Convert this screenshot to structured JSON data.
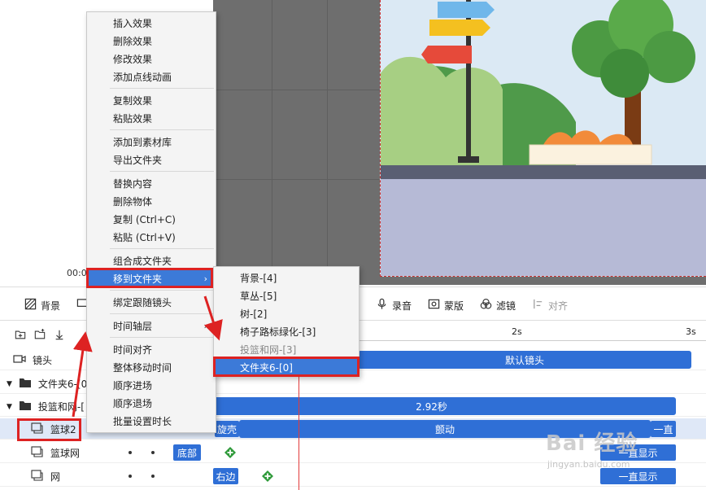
{
  "canvas": {
    "timecode": "00:0"
  },
  "toolbar": {
    "items": [
      {
        "label": "背景",
        "icon": "background-icon"
      },
      {
        "label": "录音",
        "icon": "microphone-icon"
      },
      {
        "label": "蒙版",
        "icon": "mask-icon"
      },
      {
        "label": "滤镜",
        "icon": "filter-icon"
      },
      {
        "label": "对齐",
        "icon": "align-icon"
      }
    ]
  },
  "timeline": {
    "ruler": [
      "2s",
      "3s"
    ],
    "rows": [
      {
        "label": "镜头",
        "icon": "camera-icon",
        "clip": "默认镜头"
      },
      {
        "label": "文件夹6-[0",
        "icon": "folder-icon"
      },
      {
        "label": "投篮和网-[",
        "icon": "folder-icon",
        "clip": "2.92秒"
      },
      {
        "label": "篮球2",
        "icon": "object-icon",
        "tag": "旋壳",
        "clip": "颤动",
        "end": "一直"
      },
      {
        "label": "篮球网",
        "icon": "object-icon",
        "tag": "底部",
        "end": "一直显示"
      },
      {
        "label": "网",
        "icon": "object-icon",
        "tag": "右边",
        "end": "一直显示"
      }
    ]
  },
  "context_menu": {
    "items": [
      "插入效果",
      "删除效果",
      "修改效果",
      "添加点线动画",
      "复制效果",
      "粘贴效果",
      "添加到素材库",
      "导出文件夹",
      "替换内容",
      "删除物体",
      "复制 (Ctrl+C)",
      "粘贴 (Ctrl+V)",
      "组合成文件夹",
      "移到文件夹",
      "绑定跟随镜头",
      "时间轴层",
      "时间对齐",
      "整体移动时间",
      "顺序进场",
      "顺序退场",
      "批量设置时长"
    ],
    "arrow": "›"
  },
  "sub_menu": {
    "items": [
      "背景-[4]",
      "草丛-[5]",
      "树-[2]",
      "椅子路标绿化-[3]",
      "投篮和网-[3]",
      "文件夹6-[0]"
    ]
  },
  "watermark": {
    "text": "Bai 经验",
    "sub": "jingyan.baidu.com"
  },
  "colors": {
    "accent": "#3c7ad8",
    "clip": "#2f6fd6",
    "annotation": "#dd2222"
  }
}
